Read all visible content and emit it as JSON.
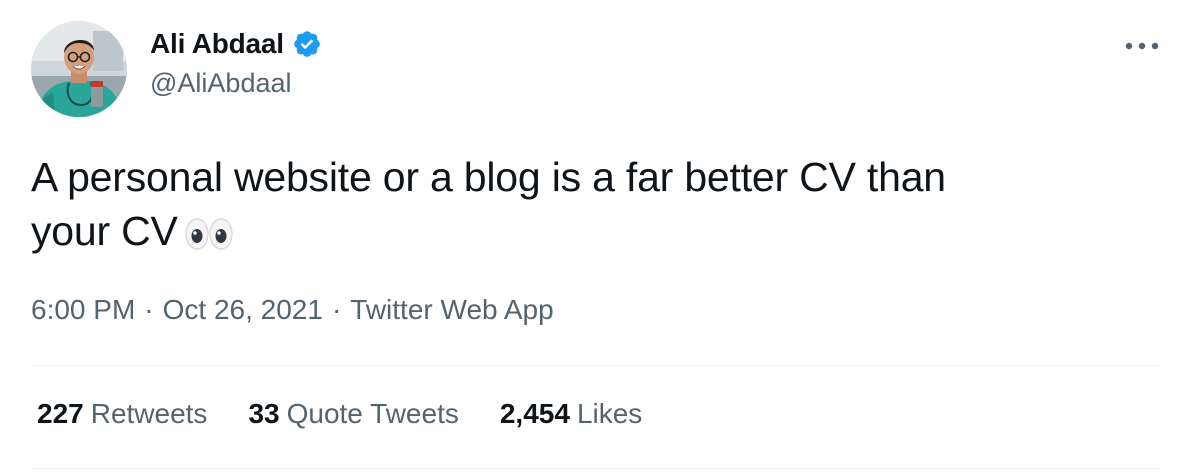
{
  "author": {
    "display_name": "Ali Abdaal",
    "handle": "@AliAbdaal",
    "verified": true,
    "avatar_icon": "profile-photo",
    "verified_icon": "verified-badge-icon"
  },
  "menu": {
    "icon": "more-options-icon"
  },
  "tweet": {
    "text_line1": "A personal website or a blog is a far better CV than",
    "text_line2": "your CV",
    "emoji": "👀"
  },
  "meta": {
    "time": "6:00 PM",
    "separator": "·",
    "date": "Oct 26, 2021",
    "source": "Twitter Web App"
  },
  "stats": [
    {
      "count": "227",
      "label": "Retweets"
    },
    {
      "count": "33",
      "label": "Quote Tweets"
    },
    {
      "count": "2,454",
      "label": "Likes"
    }
  ],
  "colors": {
    "text_primary": "#0f1419",
    "text_secondary": "#536471",
    "verified_blue": "#1d9bf0",
    "divider": "#eff3f4"
  }
}
